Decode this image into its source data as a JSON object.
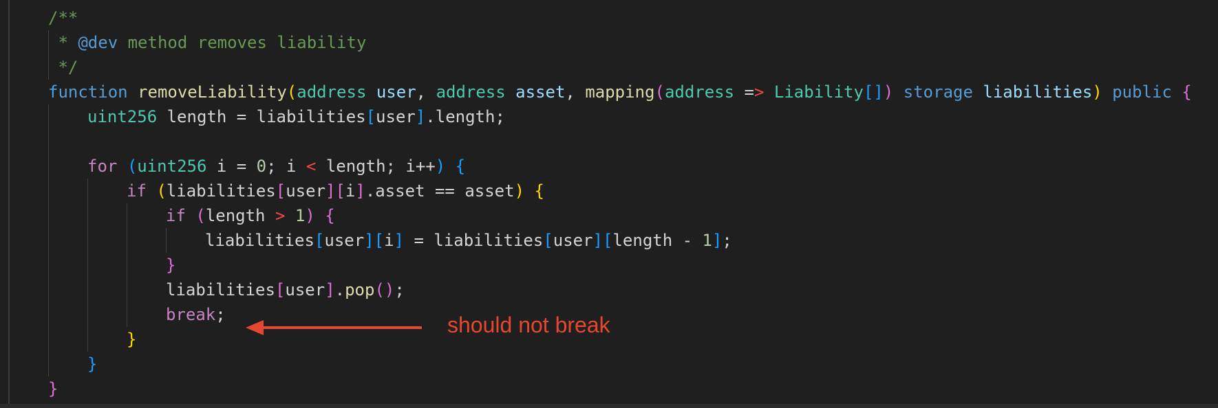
{
  "editor": {
    "lines": [
      {
        "indent": 0,
        "tokens": [
          [
            "/**",
            "t-comment"
          ]
        ]
      },
      {
        "indent": 0,
        "tokens": [
          [
            " * ",
            "t-comment"
          ],
          [
            "@dev",
            "t-doc"
          ],
          [
            " method removes liability",
            "t-comment"
          ]
        ]
      },
      {
        "indent": 0,
        "tokens": [
          [
            " */",
            "t-comment"
          ]
        ]
      },
      {
        "indent": 0,
        "tokens": [
          [
            "function",
            "t-kw"
          ],
          [
            " ",
            "t-plain"
          ],
          [
            "removeLiability",
            "t-func"
          ],
          [
            "(",
            "b1"
          ],
          [
            "address",
            "t-type"
          ],
          [
            " ",
            "t-plain"
          ],
          [
            "user",
            "t-var"
          ],
          [
            ", ",
            "t-plain"
          ],
          [
            "address",
            "t-type"
          ],
          [
            " ",
            "t-plain"
          ],
          [
            "asset",
            "t-var"
          ],
          [
            ", ",
            "t-plain"
          ],
          [
            "mapping",
            "t-func"
          ],
          [
            "(",
            "b2"
          ],
          [
            "address",
            "t-type"
          ],
          [
            " =",
            "t-plain"
          ],
          [
            ">",
            "t-op"
          ],
          [
            " ",
            "t-plain"
          ],
          [
            "Liability",
            "t-type"
          ],
          [
            "[",
            "b3"
          ],
          [
            "]",
            "b3"
          ],
          [
            ")",
            "b2"
          ],
          [
            " ",
            "t-plain"
          ],
          [
            "storage",
            "t-kw"
          ],
          [
            " ",
            "t-plain"
          ],
          [
            "liabilities",
            "t-var"
          ],
          [
            ")",
            "b1"
          ],
          [
            " ",
            "t-plain"
          ],
          [
            "public",
            "t-kw"
          ],
          [
            " ",
            "t-plain"
          ],
          [
            "{",
            "b2"
          ]
        ]
      },
      {
        "indent": 1,
        "tokens": [
          [
            "uint256",
            "t-type"
          ],
          [
            " length = liabilities",
            "t-plain"
          ],
          [
            "[",
            "b3"
          ],
          [
            "user",
            "t-plain"
          ],
          [
            "]",
            "b3"
          ],
          [
            ".length;",
            "t-plain"
          ]
        ]
      },
      {
        "indent": 0,
        "tokens": []
      },
      {
        "indent": 1,
        "tokens": [
          [
            "for",
            "t-ctrl"
          ],
          [
            " ",
            "t-plain"
          ],
          [
            "(",
            "b3"
          ],
          [
            "uint256",
            "t-type"
          ],
          [
            " i = ",
            "t-plain"
          ],
          [
            "0",
            "t-num"
          ],
          [
            "; i ",
            "t-plain"
          ],
          [
            "<",
            "t-op"
          ],
          [
            " length; i++",
            "t-plain"
          ],
          [
            ")",
            "b3"
          ],
          [
            " ",
            "t-plain"
          ],
          [
            "{",
            "b3"
          ]
        ]
      },
      {
        "indent": 2,
        "tokens": [
          [
            "if",
            "t-ctrl"
          ],
          [
            " ",
            "t-plain"
          ],
          [
            "(",
            "b1"
          ],
          [
            "liabilities",
            "t-plain"
          ],
          [
            "[",
            "b2"
          ],
          [
            "user",
            "t-plain"
          ],
          [
            "]",
            "b2"
          ],
          [
            "[",
            "b2"
          ],
          [
            "i",
            "t-plain"
          ],
          [
            "]",
            "b2"
          ],
          [
            ".asset == asset",
            "t-plain"
          ],
          [
            ")",
            "b1"
          ],
          [
            " ",
            "t-plain"
          ],
          [
            "{",
            "b1"
          ]
        ]
      },
      {
        "indent": 3,
        "tokens": [
          [
            "if",
            "t-ctrl"
          ],
          [
            " ",
            "t-plain"
          ],
          [
            "(",
            "b2"
          ],
          [
            "length ",
            "t-plain"
          ],
          [
            ">",
            "t-op"
          ],
          [
            " ",
            "t-plain"
          ],
          [
            "1",
            "t-num"
          ],
          [
            ")",
            "b2"
          ],
          [
            " ",
            "t-plain"
          ],
          [
            "{",
            "b2"
          ]
        ]
      },
      {
        "indent": 4,
        "tokens": [
          [
            "liabilities",
            "t-plain"
          ],
          [
            "[",
            "b3"
          ],
          [
            "user",
            "t-plain"
          ],
          [
            "]",
            "b3"
          ],
          [
            "[",
            "b3"
          ],
          [
            "i",
            "t-plain"
          ],
          [
            "]",
            "b3"
          ],
          [
            " = liabilities",
            "t-plain"
          ],
          [
            "[",
            "b3"
          ],
          [
            "user",
            "t-plain"
          ],
          [
            "]",
            "b3"
          ],
          [
            "[",
            "b3"
          ],
          [
            "length - ",
            "t-plain"
          ],
          [
            "1",
            "t-num"
          ],
          [
            "]",
            "b3"
          ],
          [
            ";",
            "t-plain"
          ]
        ]
      },
      {
        "indent": 3,
        "tokens": [
          [
            "}",
            "b2"
          ]
        ]
      },
      {
        "indent": 3,
        "tokens": [
          [
            "liabilities",
            "t-plain"
          ],
          [
            "[",
            "b2"
          ],
          [
            "user",
            "t-plain"
          ],
          [
            "]",
            "b2"
          ],
          [
            ".",
            "t-plain"
          ],
          [
            "pop",
            "t-func"
          ],
          [
            "(",
            "b2"
          ],
          [
            ")",
            "b2"
          ],
          [
            ";",
            "t-plain"
          ]
        ]
      },
      {
        "indent": 3,
        "tokens": [
          [
            "break",
            "t-ctrl"
          ],
          [
            ";",
            "t-plain"
          ]
        ]
      },
      {
        "indent": 2,
        "tokens": [
          [
            "}",
            "b1"
          ]
        ]
      },
      {
        "indent": 1,
        "tokens": [
          [
            "}",
            "b3"
          ]
        ]
      },
      {
        "indent": 0,
        "tokens": [
          [
            "}",
            "b2"
          ]
        ]
      }
    ]
  },
  "annotation": {
    "text": "should not break",
    "color": "#e8472f"
  }
}
